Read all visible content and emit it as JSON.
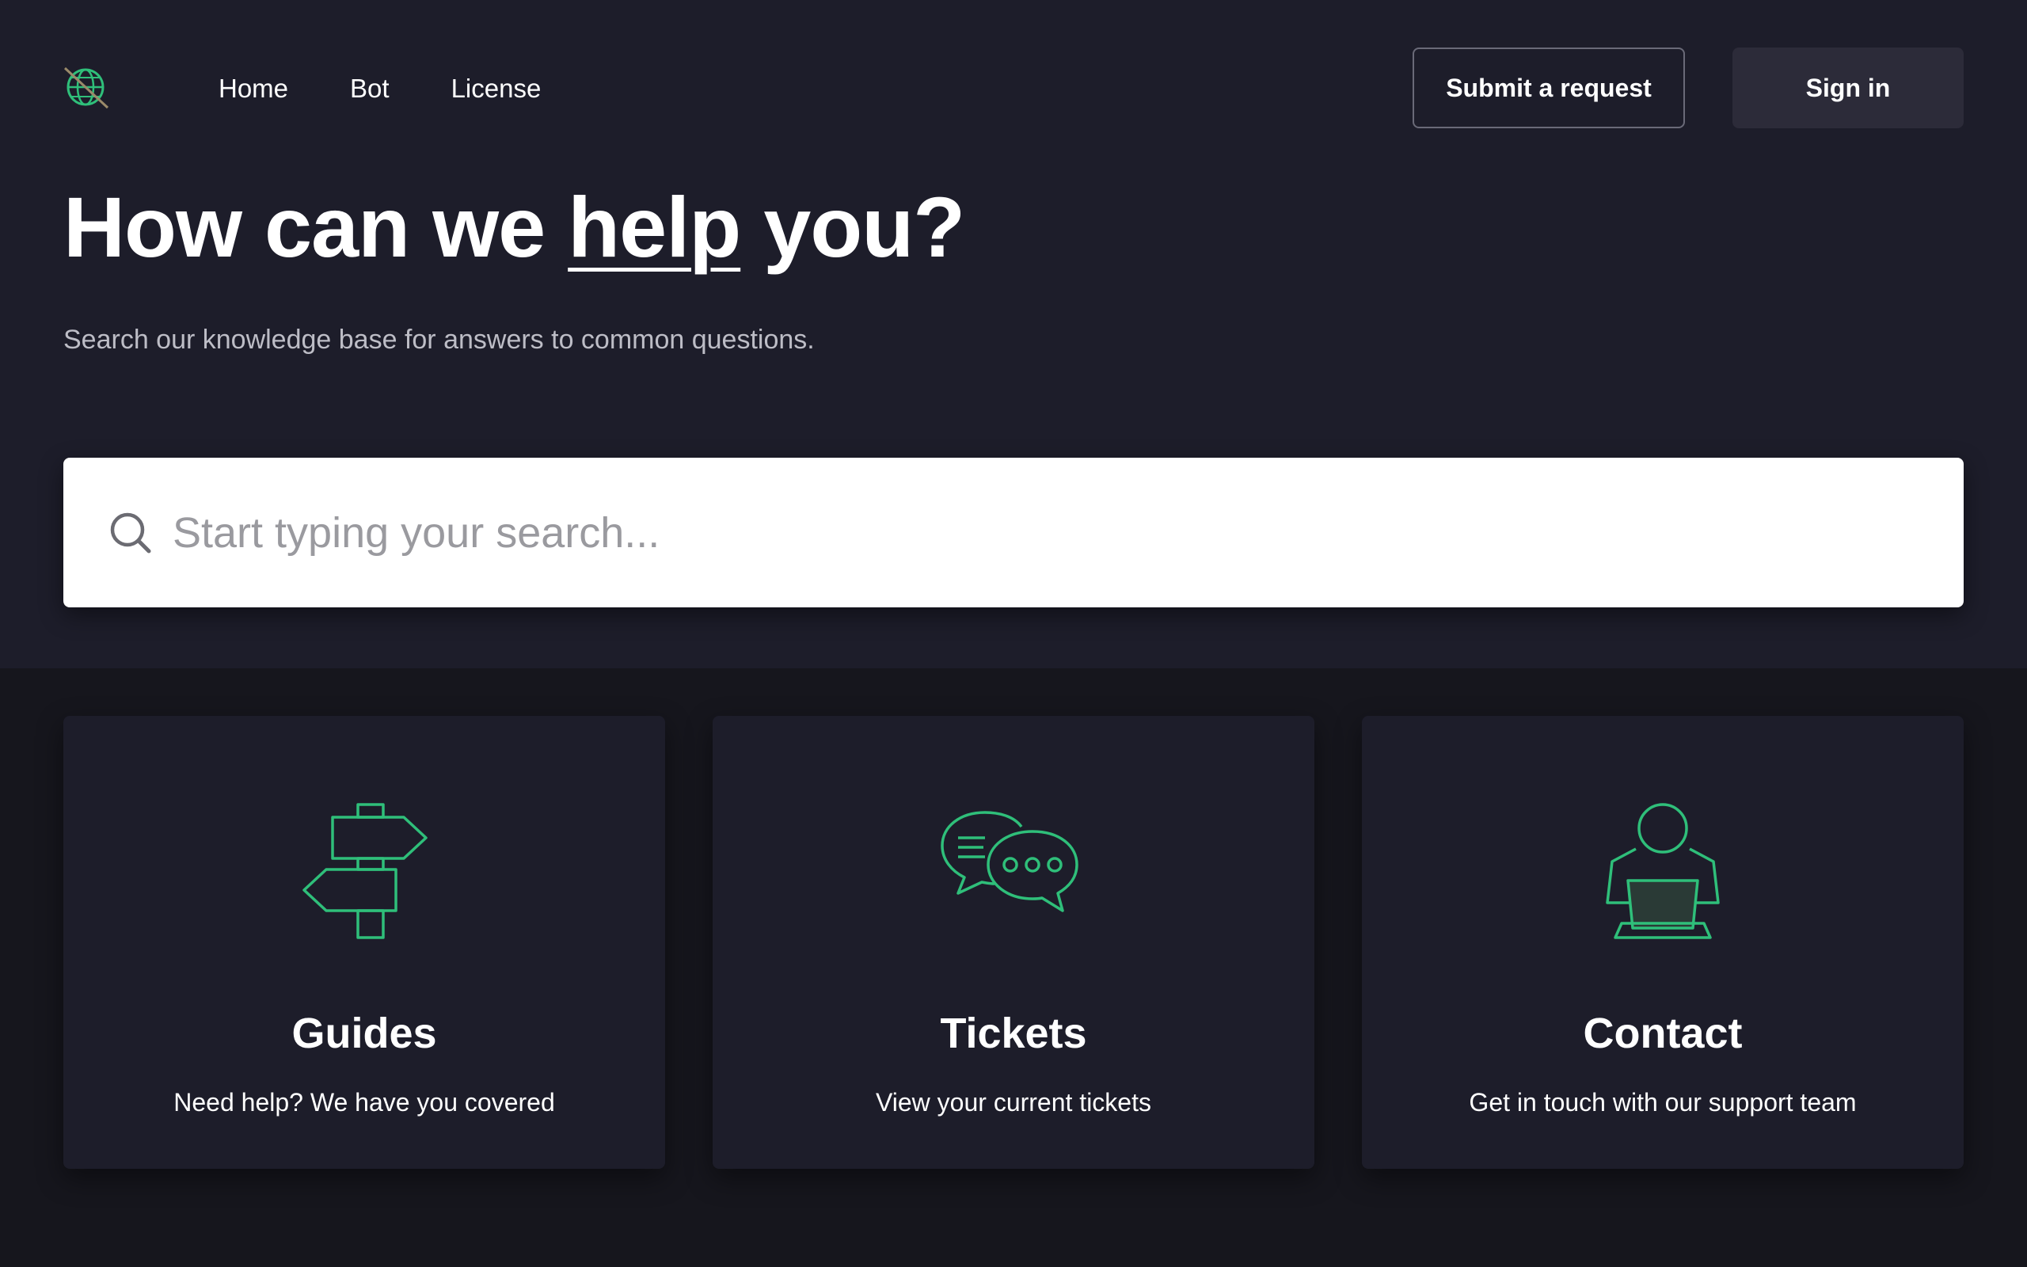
{
  "colors": {
    "accent": "#2fbf7a",
    "hero_bg": "#1d1d2a",
    "page_bg": "#16161d",
    "signin_bg": "#2c2b39"
  },
  "header": {
    "logo_icon": "globe-icon",
    "nav": [
      {
        "label": "Home"
      },
      {
        "label": "Bot"
      },
      {
        "label": "License"
      }
    ],
    "submit_request_label": "Submit a request",
    "sign_in_label": "Sign in"
  },
  "hero": {
    "headline_pre": "How can we ",
    "headline_highlight": "help",
    "headline_post": " you?",
    "subtitle": "Search our knowledge base for answers to common questions."
  },
  "search": {
    "placeholder": "Start typing your search...",
    "icon": "search-icon"
  },
  "cards": [
    {
      "icon": "signpost-icon",
      "title": "Guides",
      "description": "Need help? We have you covered"
    },
    {
      "icon": "chat-bubbles-icon",
      "title": "Tickets",
      "description": "View your current tickets"
    },
    {
      "icon": "person-laptop-icon",
      "title": "Contact",
      "description": "Get in touch with our support team"
    }
  ]
}
